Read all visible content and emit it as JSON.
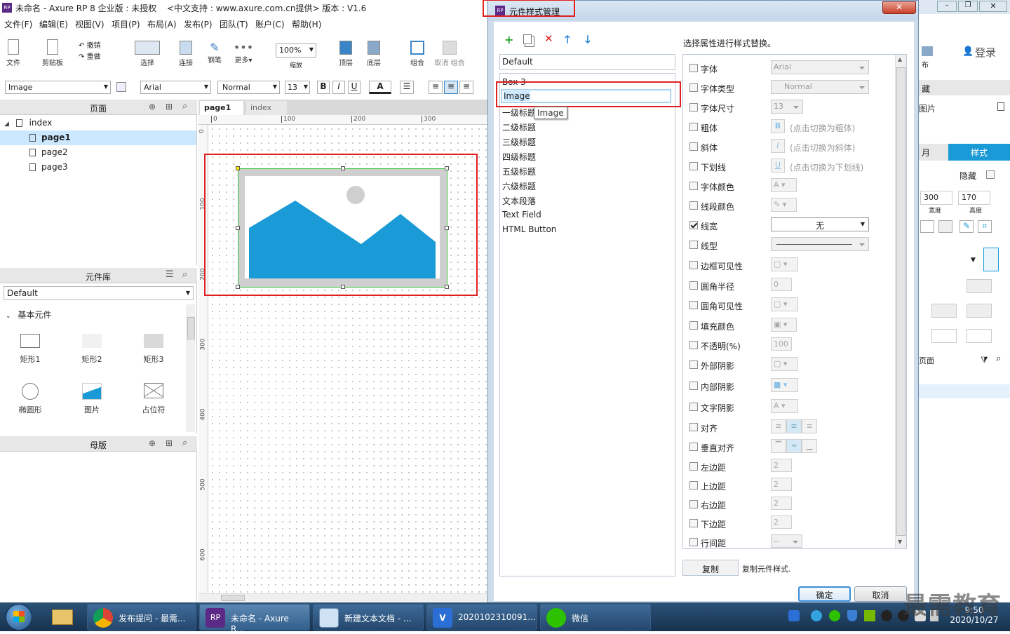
{
  "app": {
    "title": "未命名 - Axure RP 8 企业版 : 未授权",
    "title_extra": "<中文支持 : www.axure.com.cn提供> 版本 : V1.6",
    "menu": [
      "文件(F)",
      "编辑(E)",
      "视图(V)",
      "项目(P)",
      "布局(A)",
      "发布(P)",
      "团队(T)",
      "账户(C)",
      "帮助(H)"
    ],
    "toolbar": {
      "file": "文件",
      "clipboard": "剪贴板",
      "undo": "撤销",
      "redo": "重做",
      "select": "选择",
      "connect": "连接",
      "pen": "钢笔",
      "more": "更多▾",
      "zoom_value": "100%",
      "zoom_label": "缩放",
      "top": "顶层",
      "bottom": "底层",
      "group": "组合",
      "ungroup": "取消 组合"
    },
    "format_bar": {
      "style": "Image",
      "font": "Arial",
      "weight": "Normal",
      "size": "13",
      "bold": "B",
      "italic": "I",
      "underline": "U"
    },
    "pages_panel": {
      "title": "页面",
      "root": "index",
      "pages": [
        "page1",
        "page2",
        "page3"
      ]
    },
    "library_panel": {
      "title": "元件库",
      "selected": "Default",
      "group": "基本元件",
      "items": [
        "矩形1",
        "矩形2",
        "矩形3",
        "椭圆形",
        "图片",
        "占位符"
      ]
    },
    "masters_panel": {
      "title": "母版"
    },
    "tabs": [
      "page1",
      "index"
    ],
    "ruler_h": [
      "0",
      "100",
      "200",
      "300"
    ],
    "ruler_v": [
      "0",
      "100",
      "200",
      "300",
      "400",
      "500",
      "600"
    ],
    "right": {
      "login": "登录",
      "publish": "布",
      "hide": "藏",
      "image_tab": "图片",
      "tab_style": "样式",
      "tab_prop": "月",
      "hide_label": "隐藏",
      "width": "300",
      "height": "170",
      "width_label": "宽度",
      "height_label": "高度",
      "page_label": "页面"
    }
  },
  "dialog": {
    "title": "元件样式管理",
    "hint": "选择属性进行样式替换。",
    "styles": [
      "Default",
      "Box 3",
      "Image",
      "一级标题",
      "二级标题",
      "三级标题",
      "四级标题",
      "五级标题",
      "六级标题",
      "文本段落",
      "Text Field",
      "HTML Button"
    ],
    "tooltip": "Image",
    "props": [
      {
        "label": "字体",
        "value": "Arial"
      },
      {
        "label": "字体类型",
        "value": "Normal"
      },
      {
        "label": "字体尺寸",
        "value": "13"
      },
      {
        "label": "粗体",
        "value": "(点击切换为粗体)"
      },
      {
        "label": "斜体",
        "value": "(点击切换为斜体)"
      },
      {
        "label": "下划线",
        "value": "(点击切换为下划线)"
      },
      {
        "label": "字体颜色",
        "value": ""
      },
      {
        "label": "线段颜色",
        "value": ""
      },
      {
        "label": "线宽",
        "value": "无"
      },
      {
        "label": "线型",
        "value": ""
      },
      {
        "label": "边框可见性",
        "value": ""
      },
      {
        "label": "圆角半径",
        "value": "0"
      },
      {
        "label": "圆角可见性",
        "value": ""
      },
      {
        "label": "填充颜色",
        "value": ""
      },
      {
        "label": "不透明(%)",
        "value": "100"
      },
      {
        "label": "外部阴影",
        "value": ""
      },
      {
        "label": "内部阴影",
        "value": ""
      },
      {
        "label": "文字阴影",
        "value": ""
      },
      {
        "label": "对齐",
        "value": ""
      },
      {
        "label": "垂直对齐",
        "value": ""
      },
      {
        "label": "左边距",
        "value": "2"
      },
      {
        "label": "上边距",
        "value": "2"
      },
      {
        "label": "右边距",
        "value": "2"
      },
      {
        "label": "下边距",
        "value": "2"
      },
      {
        "label": "行间距",
        "value": "--"
      }
    ],
    "copy_button": "复制",
    "copy_hint": "复制元件样式.",
    "ok": "确定",
    "cancel": "取消"
  },
  "taskbar": {
    "items": [
      "发布提问 - 最需...",
      "未命名 - Axure R...",
      "新建文本文档 - ...",
      "2020102310091...",
      "微信"
    ],
    "time": "9:50",
    "date": "2020/10/27",
    "watermark": "最需教育"
  },
  "colors": {
    "accent": "#1a9ad6",
    "highlight": "#e02020",
    "selection": "#cce8ff"
  }
}
